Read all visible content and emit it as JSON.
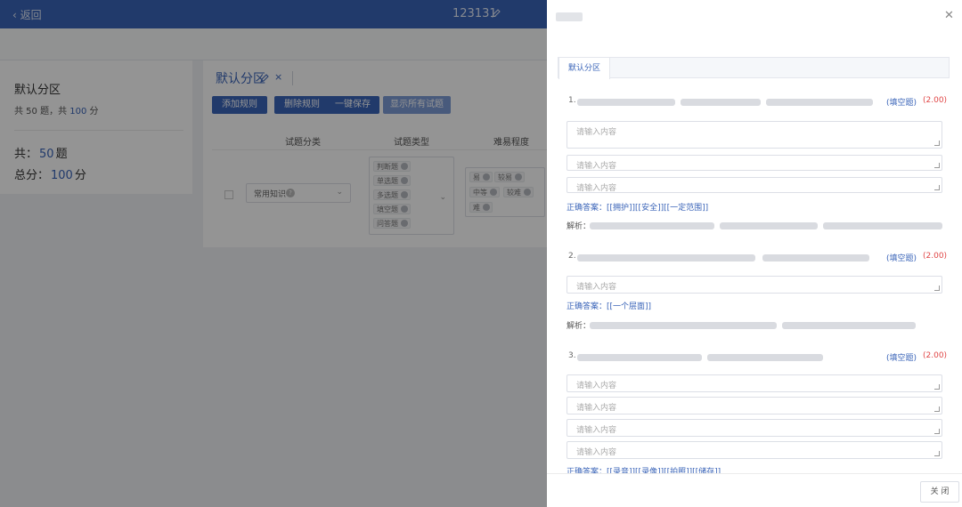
{
  "header": {
    "back_label": "‹ 返回",
    "paper_title": "123131"
  },
  "summary": {
    "title": "默认分区",
    "subtitle_prefix": "共 50 题，共 ",
    "subtitle_score": "100",
    "subtitle_suffix": " 分",
    "total_label": "共：",
    "total_count": "50",
    "total_unit": "题",
    "score_label": "总分：",
    "score_value": "100",
    "score_unit": "分"
  },
  "main": {
    "section_tab": "默认分区",
    "buttons": {
      "add_rule": "添加规则",
      "delete_rule": "删除规则",
      "save": "一键保存",
      "show_all": "显示所有试题"
    },
    "columns": {
      "category": "试题分类",
      "type": "试题类型",
      "difficulty": "难易程度"
    },
    "category_value": "常用知识",
    "type_tags": [
      "判断题",
      "单选题",
      "多选题",
      "填空题",
      "问答题"
    ],
    "difficulty_tags": [
      "易",
      "较易",
      "中等",
      "较难",
      "难"
    ]
  },
  "drawer": {
    "tab": "默认分区",
    "questions": [
      {
        "number": "1.",
        "type": "(填空题)",
        "score": "(2.00)",
        "placeholders": [
          "请输入内容",
          "请输入内容",
          "请输入内容"
        ],
        "answer": "正确答案：[[拥护]][[安全]][[一定范围]]",
        "analysis_label": "解析："
      },
      {
        "number": "2.",
        "type": "(填空题)",
        "score": "(2.00)",
        "placeholders": [
          "请输入内容"
        ],
        "answer": "正确答案：[[一个层面]]",
        "analysis_label": "解析："
      },
      {
        "number": "3.",
        "type": "(填空题)",
        "score": "(2.00)",
        "placeholders": [
          "请输入内容",
          "请输入内容",
          "请输入内容",
          "请输入内容"
        ],
        "answer": "正确答案：[[录音]][[录像]][[拍照]][[储存]]"
      }
    ],
    "close_label": "关 闭"
  }
}
